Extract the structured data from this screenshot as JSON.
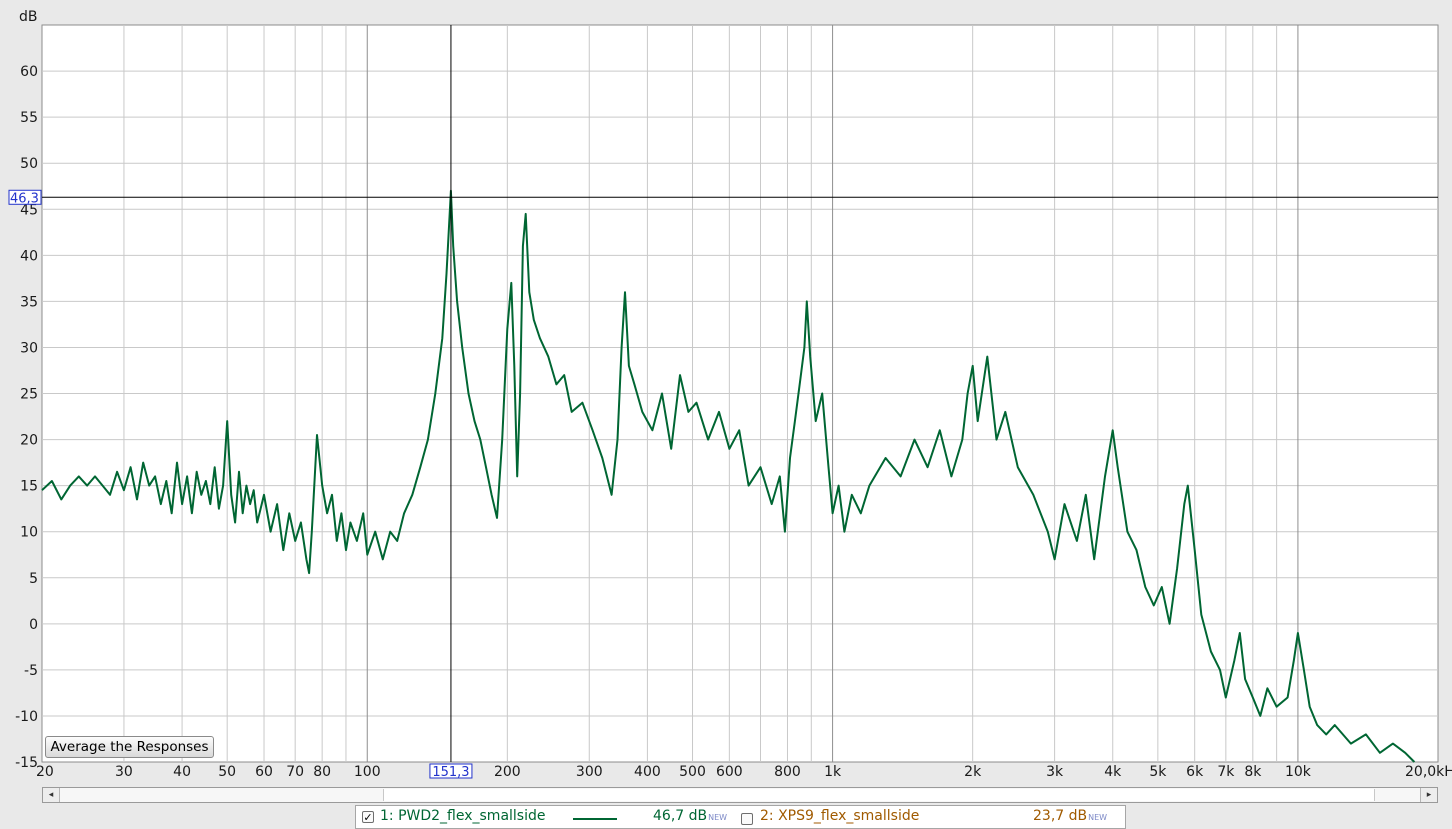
{
  "chart_data": {
    "type": "line",
    "ylabel": "dB",
    "x_scale": "log",
    "xlim": [
      20,
      20000
    ],
    "ylim": [
      -15,
      65
    ],
    "y_ticks": [
      -15,
      -10,
      -5,
      0,
      5,
      10,
      15,
      20,
      25,
      30,
      35,
      40,
      45,
      50,
      55,
      60
    ],
    "y_tick_labels": [
      "-15",
      "-10",
      "-5",
      "0",
      "5",
      "10",
      "15",
      "20",
      "25",
      "30",
      "35",
      "40",
      "45",
      "50",
      "55",
      "60"
    ],
    "x_ticks": [
      20,
      30,
      40,
      50,
      60,
      70,
      80,
      100,
      200,
      300,
      400,
      500,
      600,
      800,
      1000,
      2000,
      3000,
      4000,
      5000,
      6000,
      7000,
      8000,
      10000,
      20000
    ],
    "x_tick_labels": [
      "20",
      "30",
      "40",
      "50",
      "60",
      "70",
      "80",
      "100",
      "200",
      "300",
      "400",
      "500",
      "600",
      "800",
      "1k",
      "2k",
      "3k",
      "4k",
      "5k",
      "6k",
      "7k",
      "8k",
      "10k",
      "20,0kHz"
    ],
    "x_minor": [
      90,
      700,
      900,
      9000
    ],
    "grid": true,
    "cursor": {
      "x": 151.3,
      "y": 46.3,
      "x_label": "151,3",
      "y_label": "46,3"
    },
    "series": [
      {
        "name": "1: PWD2_flex_smallside",
        "color": "#006633",
        "points": [
          [
            20,
            14.5
          ],
          [
            21,
            15.5
          ],
          [
            22,
            13.5
          ],
          [
            23,
            15
          ],
          [
            24,
            16
          ],
          [
            25,
            15
          ],
          [
            26,
            16
          ],
          [
            27,
            15
          ],
          [
            28,
            14
          ],
          [
            29,
            16.5
          ],
          [
            30,
            14.5
          ],
          [
            31,
            17
          ],
          [
            32,
            13.5
          ],
          [
            33,
            17.5
          ],
          [
            34,
            15
          ],
          [
            35,
            16
          ],
          [
            36,
            13
          ],
          [
            37,
            15.5
          ],
          [
            38,
            12
          ],
          [
            39,
            17.5
          ],
          [
            40,
            13
          ],
          [
            41,
            16
          ],
          [
            42,
            12
          ],
          [
            43,
            16.5
          ],
          [
            44,
            14
          ],
          [
            45,
            15.5
          ],
          [
            46,
            13
          ],
          [
            47,
            17
          ],
          [
            48,
            12.5
          ],
          [
            49,
            15
          ],
          [
            50,
            22
          ],
          [
            51,
            14
          ],
          [
            52,
            11
          ],
          [
            53,
            16.5
          ],
          [
            54,
            12
          ],
          [
            55,
            15
          ],
          [
            56,
            13
          ],
          [
            57,
            14.5
          ],
          [
            58,
            11
          ],
          [
            59,
            12.5
          ],
          [
            60,
            14
          ],
          [
            62,
            10
          ],
          [
            64,
            13
          ],
          [
            66,
            8
          ],
          [
            68,
            12
          ],
          [
            70,
            9
          ],
          [
            72,
            11
          ],
          [
            74,
            7
          ],
          [
            75,
            5.5
          ],
          [
            76,
            10
          ],
          [
            78,
            20.5
          ],
          [
            80,
            15
          ],
          [
            82,
            12
          ],
          [
            84,
            14
          ],
          [
            86,
            9
          ],
          [
            88,
            12
          ],
          [
            90,
            8
          ],
          [
            92,
            11
          ],
          [
            95,
            9
          ],
          [
            98,
            12
          ],
          [
            100,
            7.5
          ],
          [
            104,
            10
          ],
          [
            108,
            7
          ],
          [
            112,
            10
          ],
          [
            116,
            9
          ],
          [
            120,
            12
          ],
          [
            125,
            14
          ],
          [
            130,
            17
          ],
          [
            135,
            20
          ],
          [
            140,
            25
          ],
          [
            145,
            31
          ],
          [
            148,
            38
          ],
          [
            151.3,
            47
          ],
          [
            153,
            41
          ],
          [
            156,
            35
          ],
          [
            160,
            30
          ],
          [
            165,
            25
          ],
          [
            170,
            22
          ],
          [
            175,
            20
          ],
          [
            180,
            17
          ],
          [
            185,
            14
          ],
          [
            190,
            11.5
          ],
          [
            195,
            20
          ],
          [
            200,
            32
          ],
          [
            204,
            37
          ],
          [
            207,
            28
          ],
          [
            210,
            16
          ],
          [
            213,
            25
          ],
          [
            216,
            41
          ],
          [
            219,
            44.5
          ],
          [
            223,
            36
          ],
          [
            228,
            33
          ],
          [
            235,
            31
          ],
          [
            245,
            29
          ],
          [
            255,
            26
          ],
          [
            265,
            27
          ],
          [
            275,
            23
          ],
          [
            290,
            24
          ],
          [
            305,
            21
          ],
          [
            320,
            18
          ],
          [
            335,
            14
          ],
          [
            345,
            20
          ],
          [
            352,
            30
          ],
          [
            358,
            36
          ],
          [
            365,
            28
          ],
          [
            375,
            26
          ],
          [
            390,
            23
          ],
          [
            410,
            21
          ],
          [
            430,
            25
          ],
          [
            450,
            19
          ],
          [
            470,
            27
          ],
          [
            490,
            23
          ],
          [
            510,
            24
          ],
          [
            540,
            20
          ],
          [
            570,
            23
          ],
          [
            600,
            19
          ],
          [
            630,
            21
          ],
          [
            660,
            15
          ],
          [
            700,
            17
          ],
          [
            740,
            13
          ],
          [
            770,
            16
          ],
          [
            790,
            10
          ],
          [
            810,
            18
          ],
          [
            830,
            22
          ],
          [
            850,
            26
          ],
          [
            870,
            30
          ],
          [
            880,
            35
          ],
          [
            895,
            29
          ],
          [
            920,
            22
          ],
          [
            950,
            25
          ],
          [
            980,
            17
          ],
          [
            1000,
            12
          ],
          [
            1030,
            15
          ],
          [
            1060,
            10
          ],
          [
            1100,
            14
          ],
          [
            1150,
            12
          ],
          [
            1200,
            15
          ],
          [
            1300,
            18
          ],
          [
            1400,
            16
          ],
          [
            1500,
            20
          ],
          [
            1600,
            17
          ],
          [
            1700,
            21
          ],
          [
            1800,
            16
          ],
          [
            1900,
            20
          ],
          [
            1950,
            25
          ],
          [
            2000,
            28
          ],
          [
            2050,
            22
          ],
          [
            2150,
            29
          ],
          [
            2250,
            20
          ],
          [
            2350,
            23
          ],
          [
            2500,
            17
          ],
          [
            2700,
            14
          ],
          [
            2900,
            10
          ],
          [
            3000,
            7
          ],
          [
            3150,
            13
          ],
          [
            3350,
            9
          ],
          [
            3500,
            14
          ],
          [
            3650,
            7
          ],
          [
            3850,
            16
          ],
          [
            4000,
            21
          ],
          [
            4100,
            17
          ],
          [
            4300,
            10
          ],
          [
            4500,
            8
          ],
          [
            4700,
            4
          ],
          [
            4900,
            2
          ],
          [
            5100,
            4
          ],
          [
            5300,
            0
          ],
          [
            5500,
            6
          ],
          [
            5700,
            13
          ],
          [
            5800,
            15
          ],
          [
            6000,
            8
          ],
          [
            6200,
            1
          ],
          [
            6500,
            -3
          ],
          [
            6800,
            -5
          ],
          [
            7000,
            -8
          ],
          [
            7300,
            -4
          ],
          [
            7500,
            -1
          ],
          [
            7700,
            -6
          ],
          [
            8000,
            -8
          ],
          [
            8300,
            -10
          ],
          [
            8600,
            -7
          ],
          [
            9000,
            -9
          ],
          [
            9500,
            -8
          ],
          [
            9800,
            -4
          ],
          [
            10000,
            -1
          ],
          [
            10300,
            -5
          ],
          [
            10600,
            -9
          ],
          [
            11000,
            -11
          ],
          [
            11500,
            -12
          ],
          [
            12000,
            -11
          ],
          [
            13000,
            -13
          ],
          [
            14000,
            -12
          ],
          [
            15000,
            -14
          ],
          [
            16000,
            -13
          ],
          [
            17000,
            -14
          ],
          [
            17800,
            -15
          ]
        ]
      }
    ]
  },
  "ui": {
    "average_button_label": "Average the Responses",
    "scroll_left_arrow": "◂",
    "scroll_right_arrow": "▸"
  },
  "legend": [
    {
      "checked": true,
      "check_glyph": "✓",
      "label": "1: PWD2_flex_smallside",
      "value": "46,7 dB",
      "tag": "NEW",
      "color": "#006633",
      "line_visible": true
    },
    {
      "checked": false,
      "check_glyph": "",
      "label": "2: XPS9_flex_smallside",
      "value": "23,7 dB",
      "tag": "NEW",
      "color": "#a05a00",
      "line_visible": false
    }
  ]
}
